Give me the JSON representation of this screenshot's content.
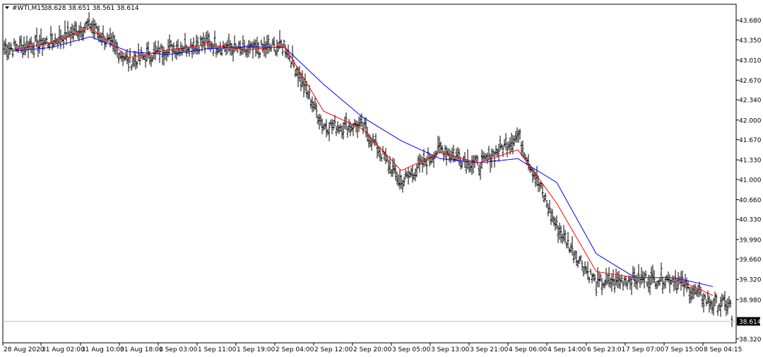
{
  "header": {
    "symbol_label": "#WTI,M15",
    "ohlc_text": "38.628 38.651 38.561 38.614"
  },
  "price_axis": {
    "labels": [
      "43.680",
      "43.350",
      "43.010",
      "42.670",
      "42.340",
      "42.000",
      "41.670",
      "41.330",
      "41.000",
      "40.660",
      "40.330",
      "39.990",
      "39.660",
      "39.320",
      "38.980",
      "38.320"
    ],
    "current_price_label": "38.614"
  },
  "time_axis": {
    "labels": [
      "28 Aug 2020",
      "31 Aug 02:00",
      "31 Aug 10:00",
      "31 Aug 18:00",
      "1 Sep 03:00",
      "1 Sep 11:00",
      "1 Sep 19:00",
      "2 Sep 04:00",
      "2 Sep 12:00",
      "2 Sep 20:00",
      "3 Sep 05:00",
      "3 Sep 13:00",
      "3 Sep 21:00",
      "4 Sep 06:00",
      "4 Sep 14:00",
      "6 Sep 23:01",
      "7 Sep 07:00",
      "7 Sep 15:00",
      "8 Sep 04:15"
    ]
  },
  "colors": {
    "bars": "#000000",
    "fast_ma": "#ff0000",
    "slow_ma": "#0000ff",
    "price_line": "#c0c0c0",
    "axis": "#000000",
    "background": "#ffffff"
  },
  "chart_data": {
    "type": "line",
    "title": "#WTI,M15",
    "timeframe": "M15",
    "ylim": [
      38.32,
      43.9
    ],
    "grid": false,
    "x": [
      "28 Aug 2020",
      "31 Aug 02:00",
      "31 Aug 10:00",
      "31 Aug 18:00",
      "1 Sep 03:00",
      "1 Sep 11:00",
      "1 Sep 19:00",
      "2 Sep 04:00",
      "2 Sep 12:00",
      "2 Sep 20:00",
      "3 Sep 05:00",
      "3 Sep 13:00",
      "3 Sep 21:00",
      "4 Sep 06:00",
      "4 Sep 14:00",
      "6 Sep 23:01",
      "7 Sep 07:00",
      "7 Sep 15:00",
      "8 Sep 04:15"
    ],
    "series": [
      {
        "kind": "ohlc-bars",
        "values": [
          43.22,
          43.32,
          43.6,
          42.98,
          43.2,
          43.3,
          43.15,
          43.26,
          41.9,
          41.9,
          40.95,
          41.52,
          41.23,
          41.75,
          40.2,
          39.25,
          39.33,
          39.33,
          38.9
        ],
        "close": 38.614
      },
      {
        "kind": "fast-ma",
        "values": [
          43.18,
          43.3,
          43.55,
          43.05,
          43.18,
          43.27,
          43.18,
          43.24,
          42.15,
          41.85,
          41.15,
          41.45,
          41.28,
          41.5,
          40.6,
          39.45,
          39.35,
          39.35,
          39.05
        ]
      },
      {
        "kind": "slow-ma",
        "values": [
          43.16,
          43.22,
          43.4,
          43.15,
          43.1,
          43.2,
          43.23,
          43.22,
          42.6,
          42.05,
          41.65,
          41.35,
          41.28,
          41.35,
          40.95,
          39.75,
          39.35,
          39.35,
          39.2
        ]
      }
    ]
  }
}
